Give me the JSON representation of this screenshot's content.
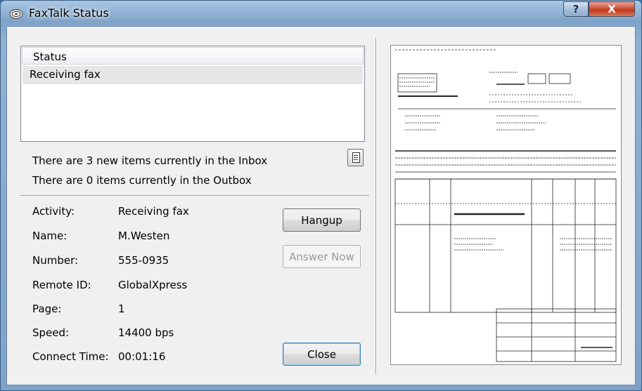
{
  "window": {
    "title": "FaxTalk Status",
    "help_label": "?",
    "close_label": "X"
  },
  "status_list": {
    "header": "Status",
    "items": [
      "Receiving fax"
    ]
  },
  "messages": {
    "inbox": "There are 3 new items currently in the Inbox",
    "outbox": "There are 0 items currently in the Outbox"
  },
  "details": [
    {
      "label": "Activity:",
      "value": "Receiving fax"
    },
    {
      "label": "Name:",
      "value": "M.Westen"
    },
    {
      "label": "Number:",
      "value": "555-0935"
    },
    {
      "label": "Remote ID:",
      "value": "GlobalXpress"
    },
    {
      "label": "Page:",
      "value": "1"
    },
    {
      "label": "Speed:",
      "value": "14400 bps"
    },
    {
      "label": "Connect Time:",
      "value": "00:01:16"
    }
  ],
  "buttons": {
    "hangup": "Hangup",
    "answer_now": "Answer Now",
    "close": "Close"
  },
  "icons": {
    "app": "fax-machine-icon",
    "open_inbox": "document-icon"
  }
}
